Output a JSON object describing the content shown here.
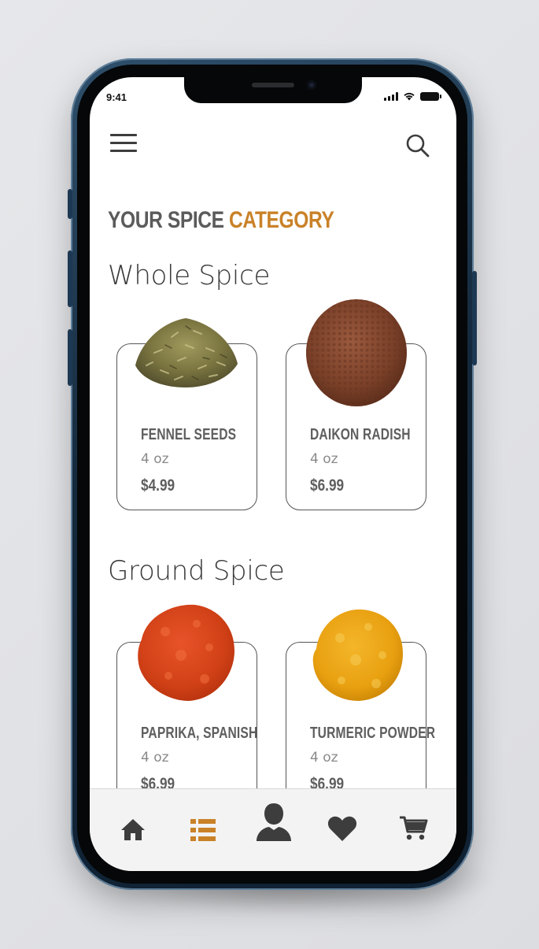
{
  "status_bar": {
    "time": "9:41"
  },
  "header": {
    "title_main": "YOUR SPICE ",
    "title_accent": "CATEGORY"
  },
  "colors": {
    "accent": "#c98228",
    "title_gray": "#5b5b5b",
    "nav_icon": "#3d3d3d",
    "nav_active": "#c98228"
  },
  "sections": [
    {
      "title": "Whole Spice",
      "products": [
        {
          "name": "FENNEL SEEDS",
          "size": "4 oz",
          "price": "$4.99",
          "image": "fennel-seeds-image"
        },
        {
          "name": "DAIKON RADISH",
          "size": "4 oz",
          "price": "$6.99",
          "image": "daikon-radish-seeds-image"
        }
      ]
    },
    {
      "title": "Ground Spice",
      "products": [
        {
          "name": "PAPRIKA, SPANISH",
          "size": "4 oz",
          "price": "$6.99",
          "image": "paprika-powder-image"
        },
        {
          "name": "TURMERIC POWDER",
          "size": "4 oz",
          "price": "$6.99",
          "image": "turmeric-powder-image"
        }
      ]
    }
  ],
  "bottom_nav": [
    {
      "icon": "home-icon",
      "active": false
    },
    {
      "icon": "list-icon",
      "active": true
    },
    {
      "icon": "profile-icon",
      "active": false
    },
    {
      "icon": "heart-icon",
      "active": false
    },
    {
      "icon": "cart-icon",
      "active": false
    }
  ]
}
